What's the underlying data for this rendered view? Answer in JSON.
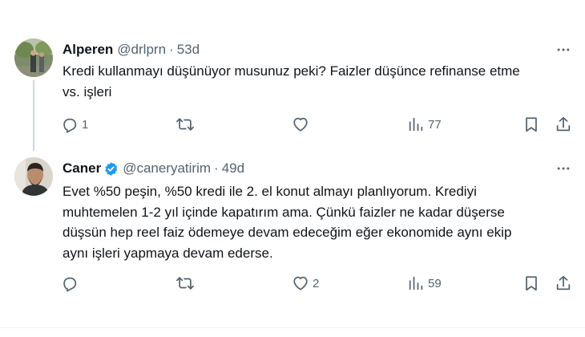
{
  "tweets": [
    {
      "author": "Alperen",
      "handle": "@drlprn",
      "separator": "·",
      "time": "53d",
      "verified": false,
      "lines": [
        "Kredi kullanmayı düşünüyor musunuz peki? Faizler düşünce refinanse etme",
        "vs. işleri"
      ],
      "replies": "1",
      "retweets": "",
      "likes": "",
      "views": "77"
    },
    {
      "author": "Caner",
      "handle": "@caneryatirim",
      "separator": "·",
      "time": "49d",
      "verified": true,
      "lines": [
        "Evet %50 peşin, %50 kredi ile 2. el konut almayı planlıyorum. Krediyi",
        "muhtemelen 1-2 yıl içinde kapatırım ama. Çünkü faizler ne kadar düşerse",
        "düşsün hep reel faiz ödemeye devam edeceğim eğer ekonomide aynı ekip",
        "aynı işleri yapmaya devam ederse."
      ],
      "replies": "",
      "retweets": "",
      "likes": "2",
      "views": "59"
    }
  ],
  "icons": {
    "reply": "reply-icon",
    "retweet": "retweet-icon",
    "like": "heart-icon",
    "views": "views-icon",
    "bookmark": "bookmark-icon",
    "share": "share-icon",
    "more": "more-icon",
    "verified": "verified-badge-icon"
  },
  "colors": {
    "text": "#0f1419",
    "secondary": "#536471",
    "verified": "#1d9bf0",
    "thread_line": "#cfd9de"
  }
}
